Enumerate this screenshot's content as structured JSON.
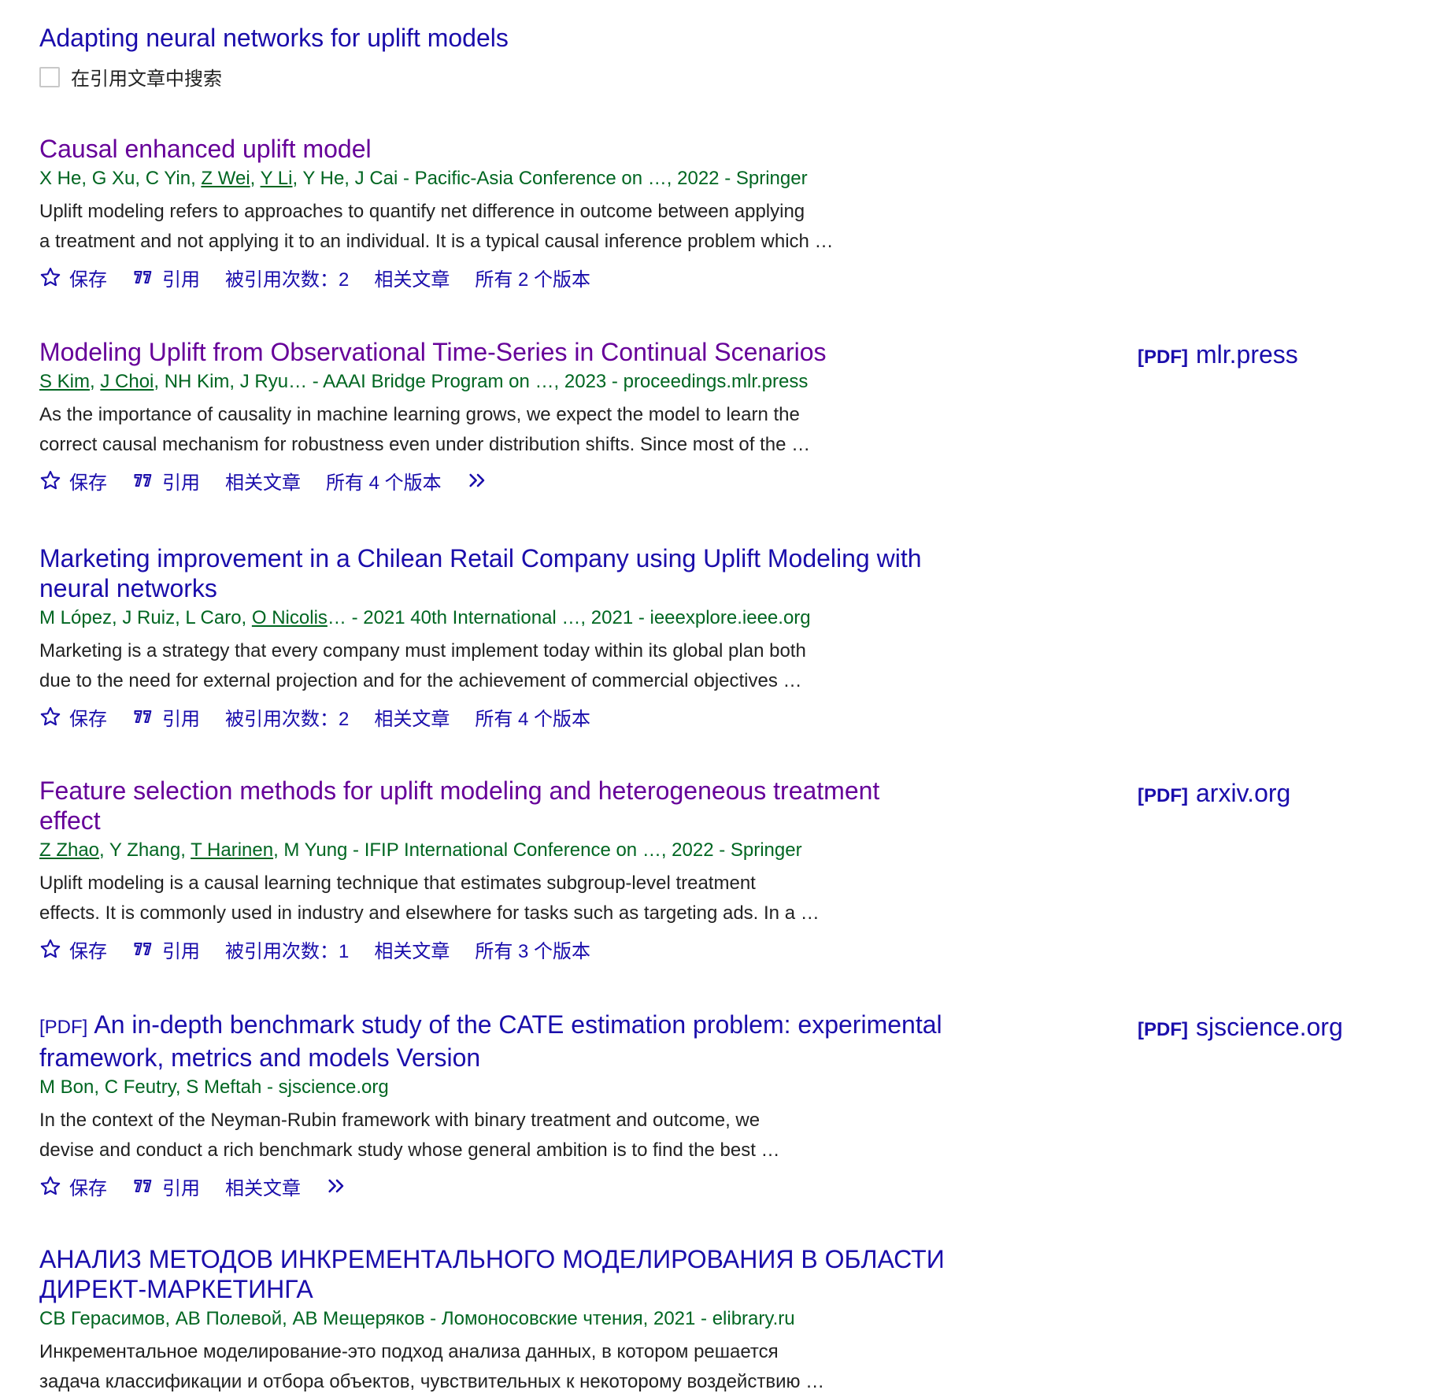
{
  "header": {
    "cited_title": "Adapting neural networks for uplift models",
    "search_within_label": "在引用文章中搜索"
  },
  "labels": {
    "save": "保存",
    "cite": "引用",
    "related": "相关文章"
  },
  "results": [
    {
      "title": "Causal enhanced uplift model",
      "authors_prefix": "X He, G Xu, C Yin, ",
      "authors_link1": "Z Wei",
      "authors_sep": ", ",
      "authors_link2": "Y Li",
      "authors_suffix": ", Y He, J Cai - Pacific-Asia Conference on …, 2022 - Springer",
      "snippet1": "Uplift modeling refers to approaches to quantify net difference in outcome between applying",
      "snippet2": "a treatment and not applying it to an individual. It is a typical causal inference problem which …",
      "cited_by": "被引用次数：2",
      "versions": "所有 2 个版本"
    },
    {
      "title": "Modeling Uplift from Observational Time-Series in Continual Scenarios",
      "authors_link1": "S Kim",
      "authors_sep1": ", ",
      "authors_link2": "J Choi",
      "authors_suffix": ", NH Kim, J Ryu… - AAAI Bridge Program on …, 2023 - proceedings.mlr.press",
      "snippet1": "As the importance of causality in machine learning grows, we expect the model to learn the",
      "snippet2": "correct causal mechanism for robustness even under distribution shifts. Since most of the …",
      "versions": "所有 4 个版本",
      "pdf_tag": "[PDF]",
      "pdf_source": "mlr.press"
    },
    {
      "title_line1": "Marketing improvement in a Chilean Retail Company using Uplift Modeling with",
      "title_line2": "neural networks",
      "authors_prefix": "M López, J Ruiz, L Caro, ",
      "authors_link1": "O Nicolis",
      "authors_suffix": "… - 2021 40th International …, 2021 - ieeexplore.ieee.org",
      "snippet1": "Marketing is a strategy that every company must implement today within its global plan both",
      "snippet2": "due to the need for external projection and for the achievement of commercial objectives …",
      "cited_by": "被引用次数：2",
      "versions": "所有 4 个版本"
    },
    {
      "title_line1": "Feature selection methods for uplift modeling and heterogeneous treatment",
      "title_line2": "effect",
      "authors_link1": "Z Zhao",
      "authors_mid": ", Y Zhang, ",
      "authors_link2": "T Harinen",
      "authors_suffix": ", M Yung - IFIP International Conference on …, 2022 - Springer",
      "snippet1": "Uplift modeling is a causal learning technique that estimates subgroup-level treatment",
      "snippet2": "effects. It is commonly used in industry and elsewhere for tasks such as targeting ads. In a …",
      "cited_by": "被引用次数：1",
      "versions": "所有 3 个版本",
      "pdf_tag": "[PDF]",
      "pdf_source": "arxiv.org"
    },
    {
      "type_tag": "[PDF]",
      "title_line1": "An in-depth benchmark study of the CATE estimation problem: experimental",
      "title_line2": "framework, metrics and models Version",
      "authors": "M Bon, C Feutry, S Meftah - sjscience.org",
      "snippet1": "In the context of the Neyman-Rubin framework with binary treatment and outcome, we",
      "snippet2": "devise and conduct a rich benchmark study whose general ambition is to find the best …",
      "pdf_tag": "[PDF]",
      "pdf_source": "sjscience.org"
    },
    {
      "title_line1": "АНАЛИЗ МЕТОДОВ ИНКРЕМЕНТАЛЬНОГО МОДЕЛИРОВАНИЯ В ОБЛАСТИ",
      "title_line2": "ДИРЕКТ-МАРКЕТИНГА",
      "authors": "СВ Герасимов, АВ Полевой, АВ Мещеряков - Ломоносовские чтения, 2021 - elibrary.ru",
      "snippet1": "Инкрементальное моделирование-это подход анализа данных, в котором решается",
      "snippet2": "задача классификации и отбора объектов, чувствительных к некоторому воздействию …"
    }
  ]
}
